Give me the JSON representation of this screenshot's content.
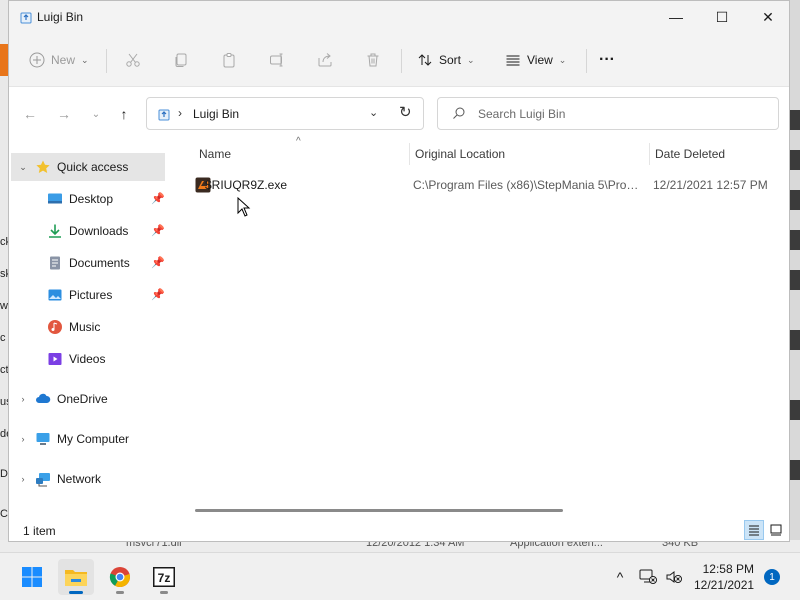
{
  "window": {
    "title": "Luigi Bin",
    "controls": {
      "minimize": "—",
      "maximize": "☐",
      "close": "✕"
    }
  },
  "toolbar": {
    "new_label": "New",
    "sort_label": "Sort",
    "view_label": "View",
    "more_label": "···"
  },
  "address": {
    "separator": "›",
    "path": "Luigi Bin",
    "search_placeholder": "Search Luigi Bin"
  },
  "navpane": {
    "items": [
      {
        "label": "Quick access",
        "icon": "star-icon"
      },
      {
        "label": "Desktop",
        "icon": "desktop-icon",
        "pinned": true
      },
      {
        "label": "Downloads",
        "icon": "download-icon",
        "pinned": true
      },
      {
        "label": "Documents",
        "icon": "document-icon",
        "pinned": true
      },
      {
        "label": "Pictures",
        "icon": "pictures-icon",
        "pinned": true
      },
      {
        "label": "Music",
        "icon": "music-icon"
      },
      {
        "label": "Videos",
        "icon": "videos-icon"
      },
      {
        "label": "OneDrive",
        "icon": "cloud-icon"
      },
      {
        "label": "My Computer",
        "icon": "computer-icon"
      },
      {
        "label": "Network",
        "icon": "network-icon"
      }
    ]
  },
  "columns": {
    "name": "Name",
    "original_location": "Original Location",
    "date_deleted": "Date Deleted"
  },
  "files": [
    {
      "name": "$RIUQR9Z.exe",
      "original_location": "C:\\Program Files (x86)\\StepMania 5\\Prog...",
      "date_deleted": "12/21/2021 12:57 PM"
    }
  ],
  "status": {
    "item_count": "1 item"
  },
  "background": {
    "left_fragments": [
      "ck",
      "sk",
      "w",
      "c",
      "ct",
      "us",
      "de",
      "D",
      "C"
    ],
    "bottom_text": [
      "msvcr71.dll",
      "12/20/2012 1:34 AM",
      "Application exten...",
      "340 KB"
    ]
  },
  "taskbar": {
    "apps": [
      "start-icon",
      "file-explorer-icon",
      "chrome-icon",
      "7zip-icon"
    ],
    "sevenzip_label": "7z",
    "tray_chevron": "^",
    "time": "12:58 PM",
    "date": "12/21/2021",
    "notifications": "1"
  },
  "colors": {
    "accent": "#0067c0",
    "selection": "#e5e5e5"
  }
}
